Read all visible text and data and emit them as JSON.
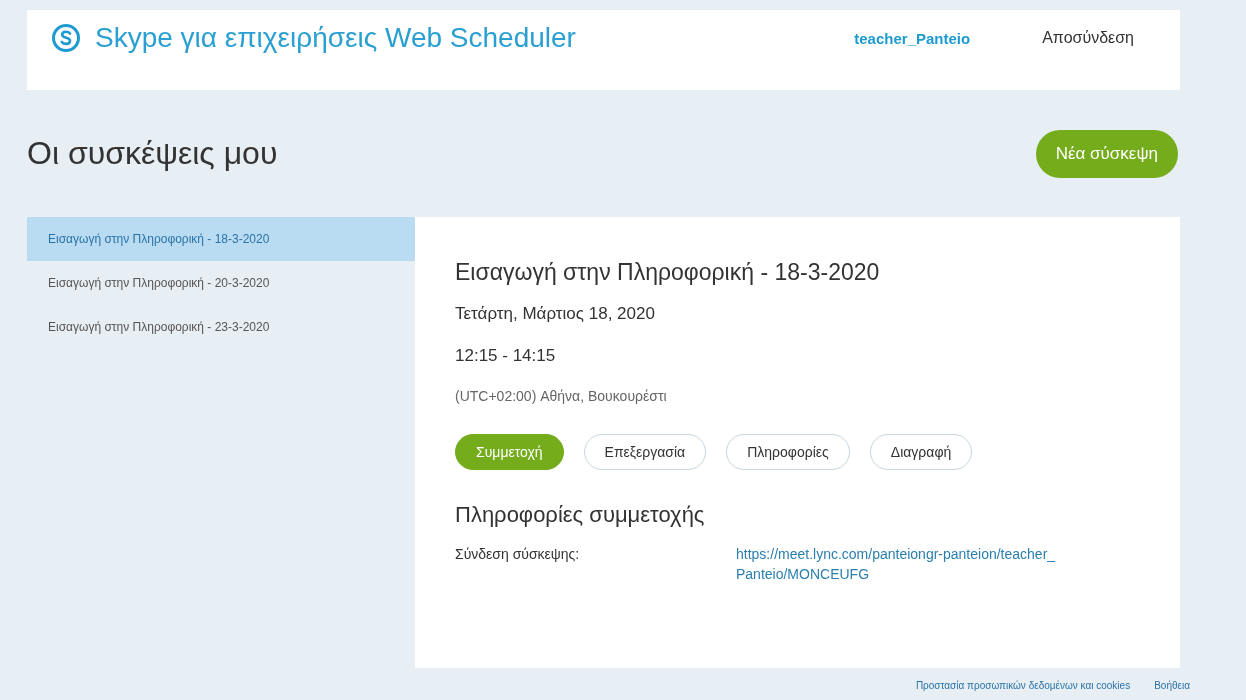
{
  "header": {
    "app_title": "Skype για επιχειρήσεις Web Scheduler",
    "user": "teacher_Panteio",
    "sign_out": "Αποσύνδεση"
  },
  "page_title": "Οι συσκέψεις μου",
  "new_meeting_button": "Νέα σύσκεψη",
  "meetings": [
    {
      "label": "Εισαγωγή στην Πληροφορική - 18-3-2020",
      "selected": true
    },
    {
      "label": "Εισαγωγή στην Πληροφορική - 20-3-2020",
      "selected": false
    },
    {
      "label": "Εισαγωγή στην Πληροφορική - 23-3-2020",
      "selected": false
    }
  ],
  "details": {
    "title": "Εισαγωγή στην Πληροφορική - 18-3-2020",
    "date": "Τετάρτη, Μάρτιος 18, 2020",
    "time": "12:15 - 14:15",
    "timezone": "(UTC+02:00) Αθήνα, Βουκουρέστι",
    "actions": [
      {
        "label": "Συμμετοχή",
        "kind": "primary"
      },
      {
        "label": "Επεξεργασία",
        "kind": "secondary"
      },
      {
        "label": "Πληροφορίες",
        "kind": "secondary"
      },
      {
        "label": "Διαγραφή",
        "kind": "secondary"
      }
    ],
    "join_heading": "Πληροφορίες συμμετοχής",
    "join_label": "Σύνδεση σύσκεψης:",
    "join_link": "https://meet.lync.com/panteiongr-panteion/teacher_Panteio/MONCEUFG"
  },
  "footer": {
    "privacy": "Προστασία προσωπικών δεδομένων και cookies",
    "help": "Βοήθεια"
  }
}
